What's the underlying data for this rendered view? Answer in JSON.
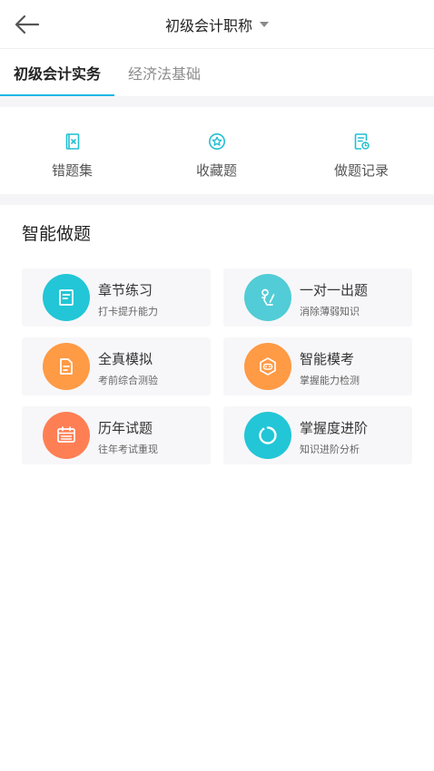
{
  "header": {
    "title": "初级会计职称"
  },
  "tabs": [
    {
      "label": "初级会计实务",
      "active": true
    },
    {
      "label": "经济法基础",
      "active": false
    }
  ],
  "quick": [
    {
      "label": "错题集",
      "icon": "error-book-icon"
    },
    {
      "label": "收藏题",
      "icon": "star-icon"
    },
    {
      "label": "做题记录",
      "icon": "record-icon"
    }
  ],
  "section": {
    "title": "智能做题"
  },
  "cards": [
    {
      "title": "章节练习",
      "subtitle": "打卡提升能力",
      "icon": "document-icon"
    },
    {
      "title": "一对一出题",
      "subtitle": "消除薄弱知识",
      "icon": "person-icon"
    },
    {
      "title": "全真模拟",
      "subtitle": "考前综合测验",
      "icon": "paper-icon"
    },
    {
      "title": "智能模考",
      "subtitle": "掌握能力检测",
      "icon": "robot-icon"
    },
    {
      "title": "历年试题",
      "subtitle": "往年考试重现",
      "icon": "calendar-icon"
    },
    {
      "title": "掌握度进阶",
      "subtitle": "知识进阶分析",
      "icon": "progress-ring-icon"
    }
  ],
  "colors": {
    "accent": "#1fb6e6",
    "teal": "#22c6d6",
    "orange": "#ff9a45"
  }
}
